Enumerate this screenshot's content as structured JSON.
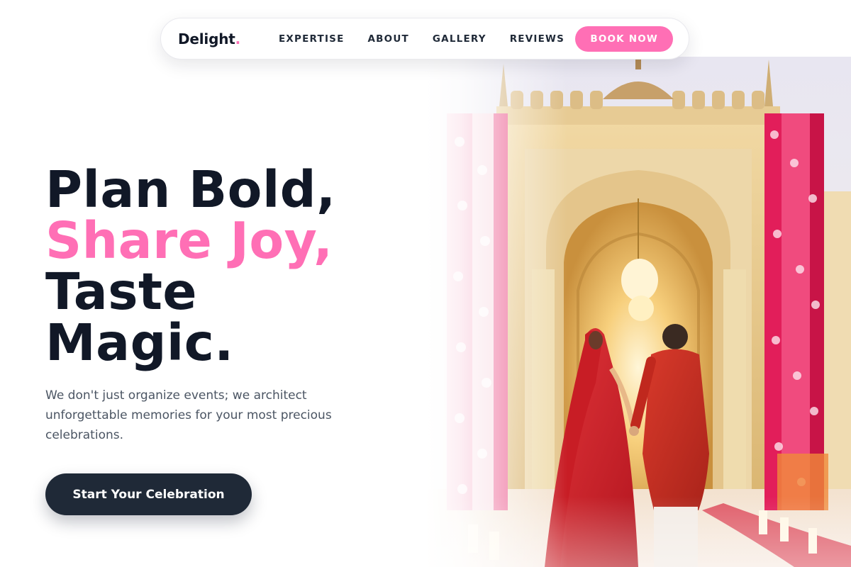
{
  "brand": {
    "name": "Delight",
    "dot": "."
  },
  "nav": {
    "links": [
      "EXPERTISE",
      "ABOUT",
      "GALLERY",
      "REVIEWS"
    ],
    "book_label": "BOOK NOW"
  },
  "hero": {
    "headline": [
      "Plan Bold,",
      "Share Joy,",
      "Taste",
      "Magic."
    ],
    "subtext": "We don't just organize events; we architect unforgettable memories for your most precious celebrations.",
    "cta_label": "Start Your Celebration",
    "image_icon": "wedding-photo"
  },
  "colors": {
    "accent": "#ff6fb5",
    "dark": "#111827",
    "button_dark": "#1f2937",
    "body_text": "#4b5563"
  }
}
